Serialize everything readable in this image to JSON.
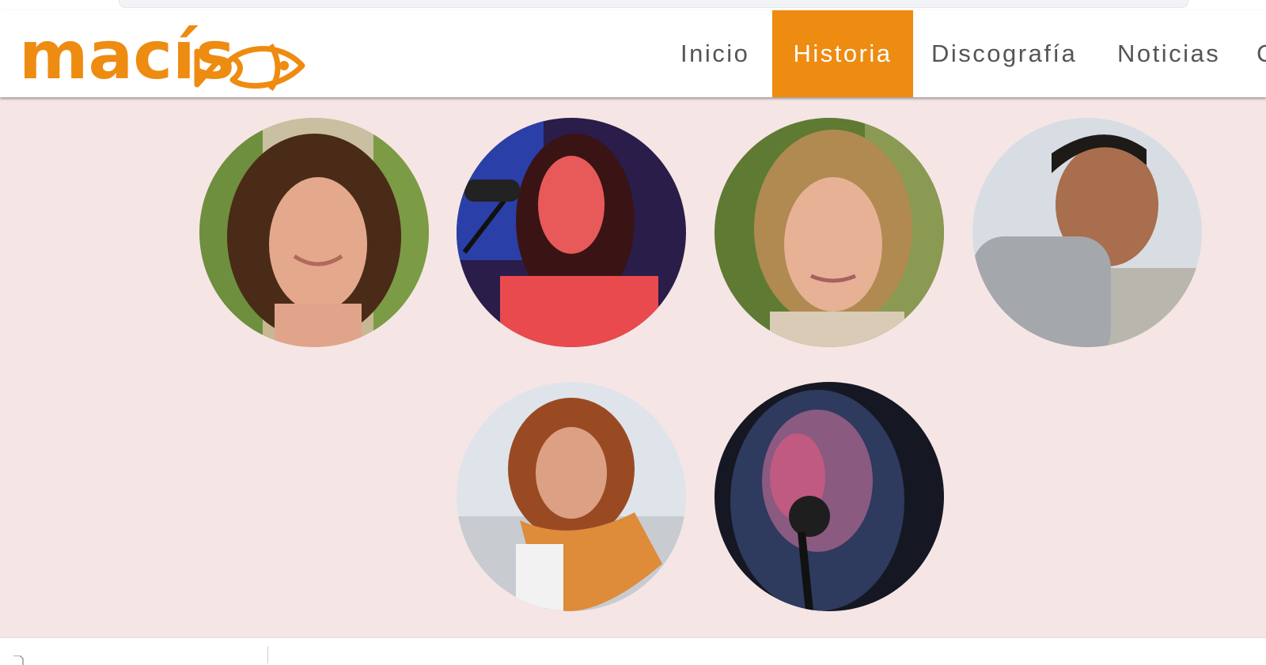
{
  "site": {
    "logo_text": "macís",
    "brand_color": "#ee8b11",
    "background_color": "#f5e6e5"
  },
  "nav": {
    "items": [
      {
        "label": "Inicio",
        "active": false
      },
      {
        "label": "Historia",
        "active": true
      },
      {
        "label": "Discografía",
        "active": false
      },
      {
        "label": "Noticias",
        "active": false
      },
      {
        "label": "C",
        "active": false
      }
    ]
  },
  "members": [
    {
      "photo": "woman-curly-hair-smiling-portrait"
    },
    {
      "photo": "woman-singing-at-microphone"
    },
    {
      "photo": "woman-blonde-hair-portrait"
    },
    {
      "photo": "man-short-hair-looking-back"
    },
    {
      "photo": "woman-red-curly-hair-orange-scarf"
    },
    {
      "photo": "man-singing-at-microphone"
    }
  ],
  "footer": {
    "icons": [
      "file-icon"
    ]
  }
}
